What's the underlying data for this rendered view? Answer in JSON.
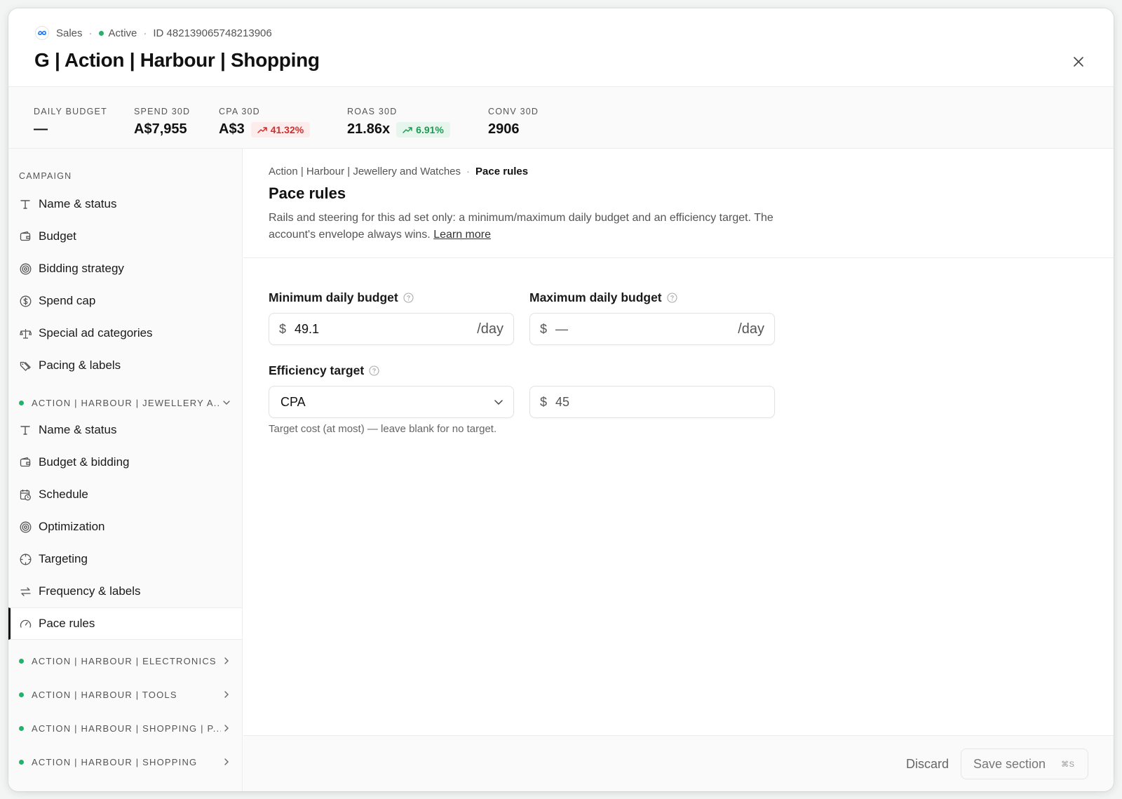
{
  "header": {
    "platform": "Sales",
    "status": "Active",
    "id_text": "ID 4821390657482139​06",
    "title": "G | Action | Harbour | Shopping",
    "colors": {
      "active_dot": "#22b36a"
    }
  },
  "stats": [
    {
      "label": "DAILY BUDGET",
      "value": "—"
    },
    {
      "label": "SPEND 30D",
      "value": "A$7,955"
    },
    {
      "label": "CPA 30D",
      "value": "A$3",
      "delta": "41.32%",
      "delta_tone": "bad",
      "delta_color": "#d12d2d"
    },
    {
      "label": "ROAS 30D",
      "value": "21.86x",
      "delta": "6.91%",
      "delta_tone": "good",
      "delta_color": "#1f9a54"
    },
    {
      "label": "CONV 30D",
      "value": "2906"
    }
  ],
  "sidebar": {
    "campaign_heading": "CAMPAIGN",
    "campaign_items": [
      {
        "label": "Name & status",
        "icon": "text-icon"
      },
      {
        "label": "Budget",
        "icon": "wallet-icon"
      },
      {
        "label": "Bidding strategy",
        "icon": "target-icon"
      },
      {
        "label": "Spend cap",
        "icon": "dollar-circle-icon"
      },
      {
        "label": "Special ad categories",
        "icon": "scale-icon"
      },
      {
        "label": "Pacing & labels",
        "icon": "tag-icon"
      }
    ],
    "open_group": "ACTION | HARBOUR | JEWELLERY A...",
    "adset_items": [
      {
        "label": "Name & status",
        "icon": "text-icon"
      },
      {
        "label": "Budget & bidding",
        "icon": "wallet-icon"
      },
      {
        "label": "Schedule",
        "icon": "calendar-clock-icon"
      },
      {
        "label": "Optimization",
        "icon": "target-icon"
      },
      {
        "label": "Targeting",
        "icon": "crosshair-icon"
      },
      {
        "label": "Frequency & labels",
        "icon": "repeat-icon"
      },
      {
        "label": "Pace rules",
        "icon": "gauge-icon",
        "active": true
      }
    ],
    "collapsed_groups": [
      "ACTION | HARBOUR | ELECTRONICS",
      "ACTION | HARBOUR | TOOLS",
      "ACTION | HARBOUR | SHOPPING | P...",
      "ACTION | HARBOUR | SHOPPING"
    ]
  },
  "main": {
    "breadcrumb_parent": "Action | Harbour | Jewellery and Watches",
    "breadcrumb_current": "Pace rules",
    "title": "Pace rules",
    "description": "Rails and steering for this ad set only: a minimum/maximum daily budget and an efficiency target. The account's envelope always wins.",
    "learn_more": "Learn more",
    "min_label": "Minimum daily budget",
    "min_currency": "$",
    "min_value": "49.1",
    "min_suffix": "/day",
    "max_label": "Maximum daily budget",
    "max_currency": "$",
    "max_value": "—",
    "max_suffix": "/day",
    "eff_label": "Efficiency target",
    "eff_type": "CPA",
    "eff_currency": "$",
    "eff_value": "45",
    "eff_hint": "Target cost (at most) — leave blank for no target."
  },
  "footer": {
    "discard": "Discard",
    "save": "Save section",
    "shortcut": "⌘S"
  }
}
